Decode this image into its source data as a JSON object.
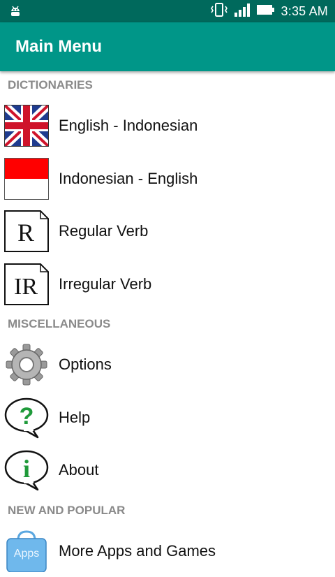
{
  "status_bar": {
    "time": "3:35 AM",
    "icons": [
      "android-debug-icon",
      "vibrate-icon",
      "signal-icon",
      "battery-icon"
    ]
  },
  "app_bar": {
    "title": "Main Menu"
  },
  "sections": {
    "dictionaries": {
      "header": "DICTIONARIES",
      "items": [
        {
          "label": "English - Indonesian",
          "icon": "uk-flag-icon"
        },
        {
          "label": "Indonesian - English",
          "icon": "indonesia-flag-icon"
        },
        {
          "label": "Regular Verb",
          "icon": "r-document-icon",
          "icon_text": "R"
        },
        {
          "label": "Irregular Verb",
          "icon": "ir-document-icon",
          "icon_text": "IR"
        }
      ]
    },
    "misc": {
      "header": "MISCELLANEOUS",
      "items": [
        {
          "label": "Options",
          "icon": "gear-icon"
        },
        {
          "label": "Help",
          "icon": "help-bubble-icon",
          "icon_text": "?"
        },
        {
          "label": "About",
          "icon": "info-bubble-icon",
          "icon_text": "i"
        }
      ]
    },
    "new": {
      "header": "NEW AND POPULAR",
      "items": [
        {
          "label": "More Apps and Games",
          "icon": "app-store-bag-icon",
          "icon_text": "Apps"
        }
      ]
    }
  },
  "colors": {
    "status_bar": "#00695c",
    "app_bar": "#009688",
    "section_header": "#8a8a8a"
  }
}
